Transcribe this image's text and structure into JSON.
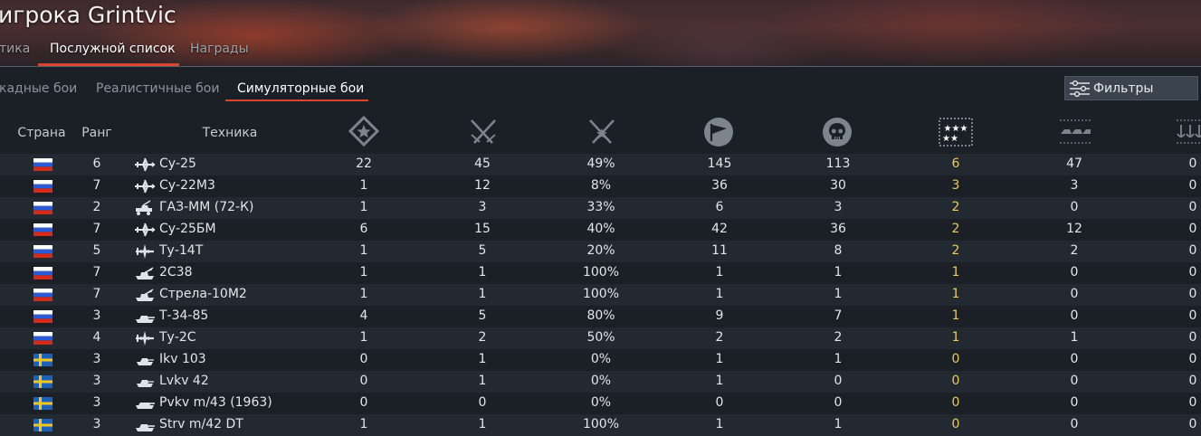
{
  "page_title": "игрока Grintvic",
  "main_tabs": [
    {
      "label": "тика"
    },
    {
      "label": "Послужной список"
    },
    {
      "label": "Награды"
    }
  ],
  "sub_tabs": [
    {
      "label": "кадные бои"
    },
    {
      "label": "Реалистичные бои"
    },
    {
      "label": "Симуляторные бои"
    }
  ],
  "filter_button": {
    "label": "Фильтры",
    "icon": "sliders-icon"
  },
  "columns": {
    "country": "Страна",
    "rank": "Ранг",
    "vehicle": "Техника",
    "icons": [
      "star-shield-icon",
      "crossed-swords-icon",
      "crossed-swords-star-icon",
      "flag-capture-icon",
      "skull-icon",
      "three-stars-icon",
      "ground-units-icon",
      "naval-units-icon"
    ]
  },
  "colors": {
    "accent": "#d9452d",
    "gold": "#f0c660"
  },
  "rows": [
    {
      "flag": "russia",
      "rank": "6",
      "type": "jet-icon",
      "name": "Су-25",
      "v1": "22",
      "v2": "45",
      "pct": "49%",
      "v4": "145",
      "v5": "113",
      "gold": "6",
      "v7": "47",
      "v8": "0"
    },
    {
      "flag": "russia",
      "rank": "7",
      "type": "jet-icon",
      "name": "Су-22М3",
      "v1": "1",
      "v2": "12",
      "pct": "8%",
      "v4": "36",
      "v5": "30",
      "gold": "3",
      "v7": "3",
      "v8": "0"
    },
    {
      "flag": "russia",
      "rank": "2",
      "type": "spaa-truck-icon",
      "name": "ГАЗ-ММ (72-К)",
      "v1": "1",
      "v2": "3",
      "pct": "33%",
      "v4": "6",
      "v5": "3",
      "gold": "2",
      "v7": "0",
      "v8": "0"
    },
    {
      "flag": "russia",
      "rank": "7",
      "type": "jet-icon",
      "name": "Су-25БМ",
      "v1": "6",
      "v2": "15",
      "pct": "40%",
      "v4": "42",
      "v5": "36",
      "gold": "2",
      "v7": "12",
      "v8": "0"
    },
    {
      "flag": "russia",
      "rank": "5",
      "type": "bomber-icon",
      "name": "Ту-14Т",
      "v1": "1",
      "v2": "5",
      "pct": "20%",
      "v4": "11",
      "v5": "8",
      "gold": "2",
      "v7": "2",
      "v8": "0"
    },
    {
      "flag": "russia",
      "rank": "7",
      "type": "spaa-icon",
      "name": "2С38",
      "v1": "1",
      "v2": "1",
      "pct": "100%",
      "v4": "1",
      "v5": "1",
      "gold": "1",
      "v7": "0",
      "v8": "0"
    },
    {
      "flag": "russia",
      "rank": "7",
      "type": "spaa-icon",
      "name": "Стрела-10М2",
      "v1": "1",
      "v2": "1",
      "pct": "100%",
      "v4": "1",
      "v5": "1",
      "gold": "1",
      "v7": "0",
      "v8": "0"
    },
    {
      "flag": "russia",
      "rank": "3",
      "type": "tank-icon",
      "name": "Т-34-85",
      "v1": "4",
      "v2": "5",
      "pct": "80%",
      "v4": "9",
      "v5": "7",
      "gold": "1",
      "v7": "0",
      "v8": "0"
    },
    {
      "flag": "russia",
      "rank": "4",
      "type": "bomber-icon",
      "name": "Ту-2С",
      "v1": "1",
      "v2": "2",
      "pct": "50%",
      "v4": "2",
      "v5": "2",
      "gold": "1",
      "v7": "1",
      "v8": "0"
    },
    {
      "flag": "sweden",
      "rank": "3",
      "type": "light-tank-icon",
      "name": "Ikv 103",
      "v1": "0",
      "v2": "1",
      "pct": "0%",
      "v4": "1",
      "v5": "1",
      "gold": "0",
      "v7": "0",
      "v8": "0"
    },
    {
      "flag": "sweden",
      "rank": "3",
      "type": "light-tank-icon",
      "name": "Lvkv 42",
      "v1": "0",
      "v2": "1",
      "pct": "0%",
      "v4": "1",
      "v5": "0",
      "gold": "0",
      "v7": "0",
      "v8": "0"
    },
    {
      "flag": "sweden",
      "rank": "3",
      "type": "tank-destroyer-icon",
      "name": "Pvkv m/43 (1963)",
      "v1": "0",
      "v2": "0",
      "pct": "0%",
      "v4": "0",
      "v5": "0",
      "gold": "0",
      "v7": "0",
      "v8": "0"
    },
    {
      "flag": "sweden",
      "rank": "3",
      "type": "tank-icon",
      "name": "Strv m/42 DT",
      "v1": "1",
      "v2": "1",
      "pct": "100%",
      "v4": "1",
      "v5": "1",
      "gold": "0",
      "v7": "0",
      "v8": "0"
    }
  ]
}
